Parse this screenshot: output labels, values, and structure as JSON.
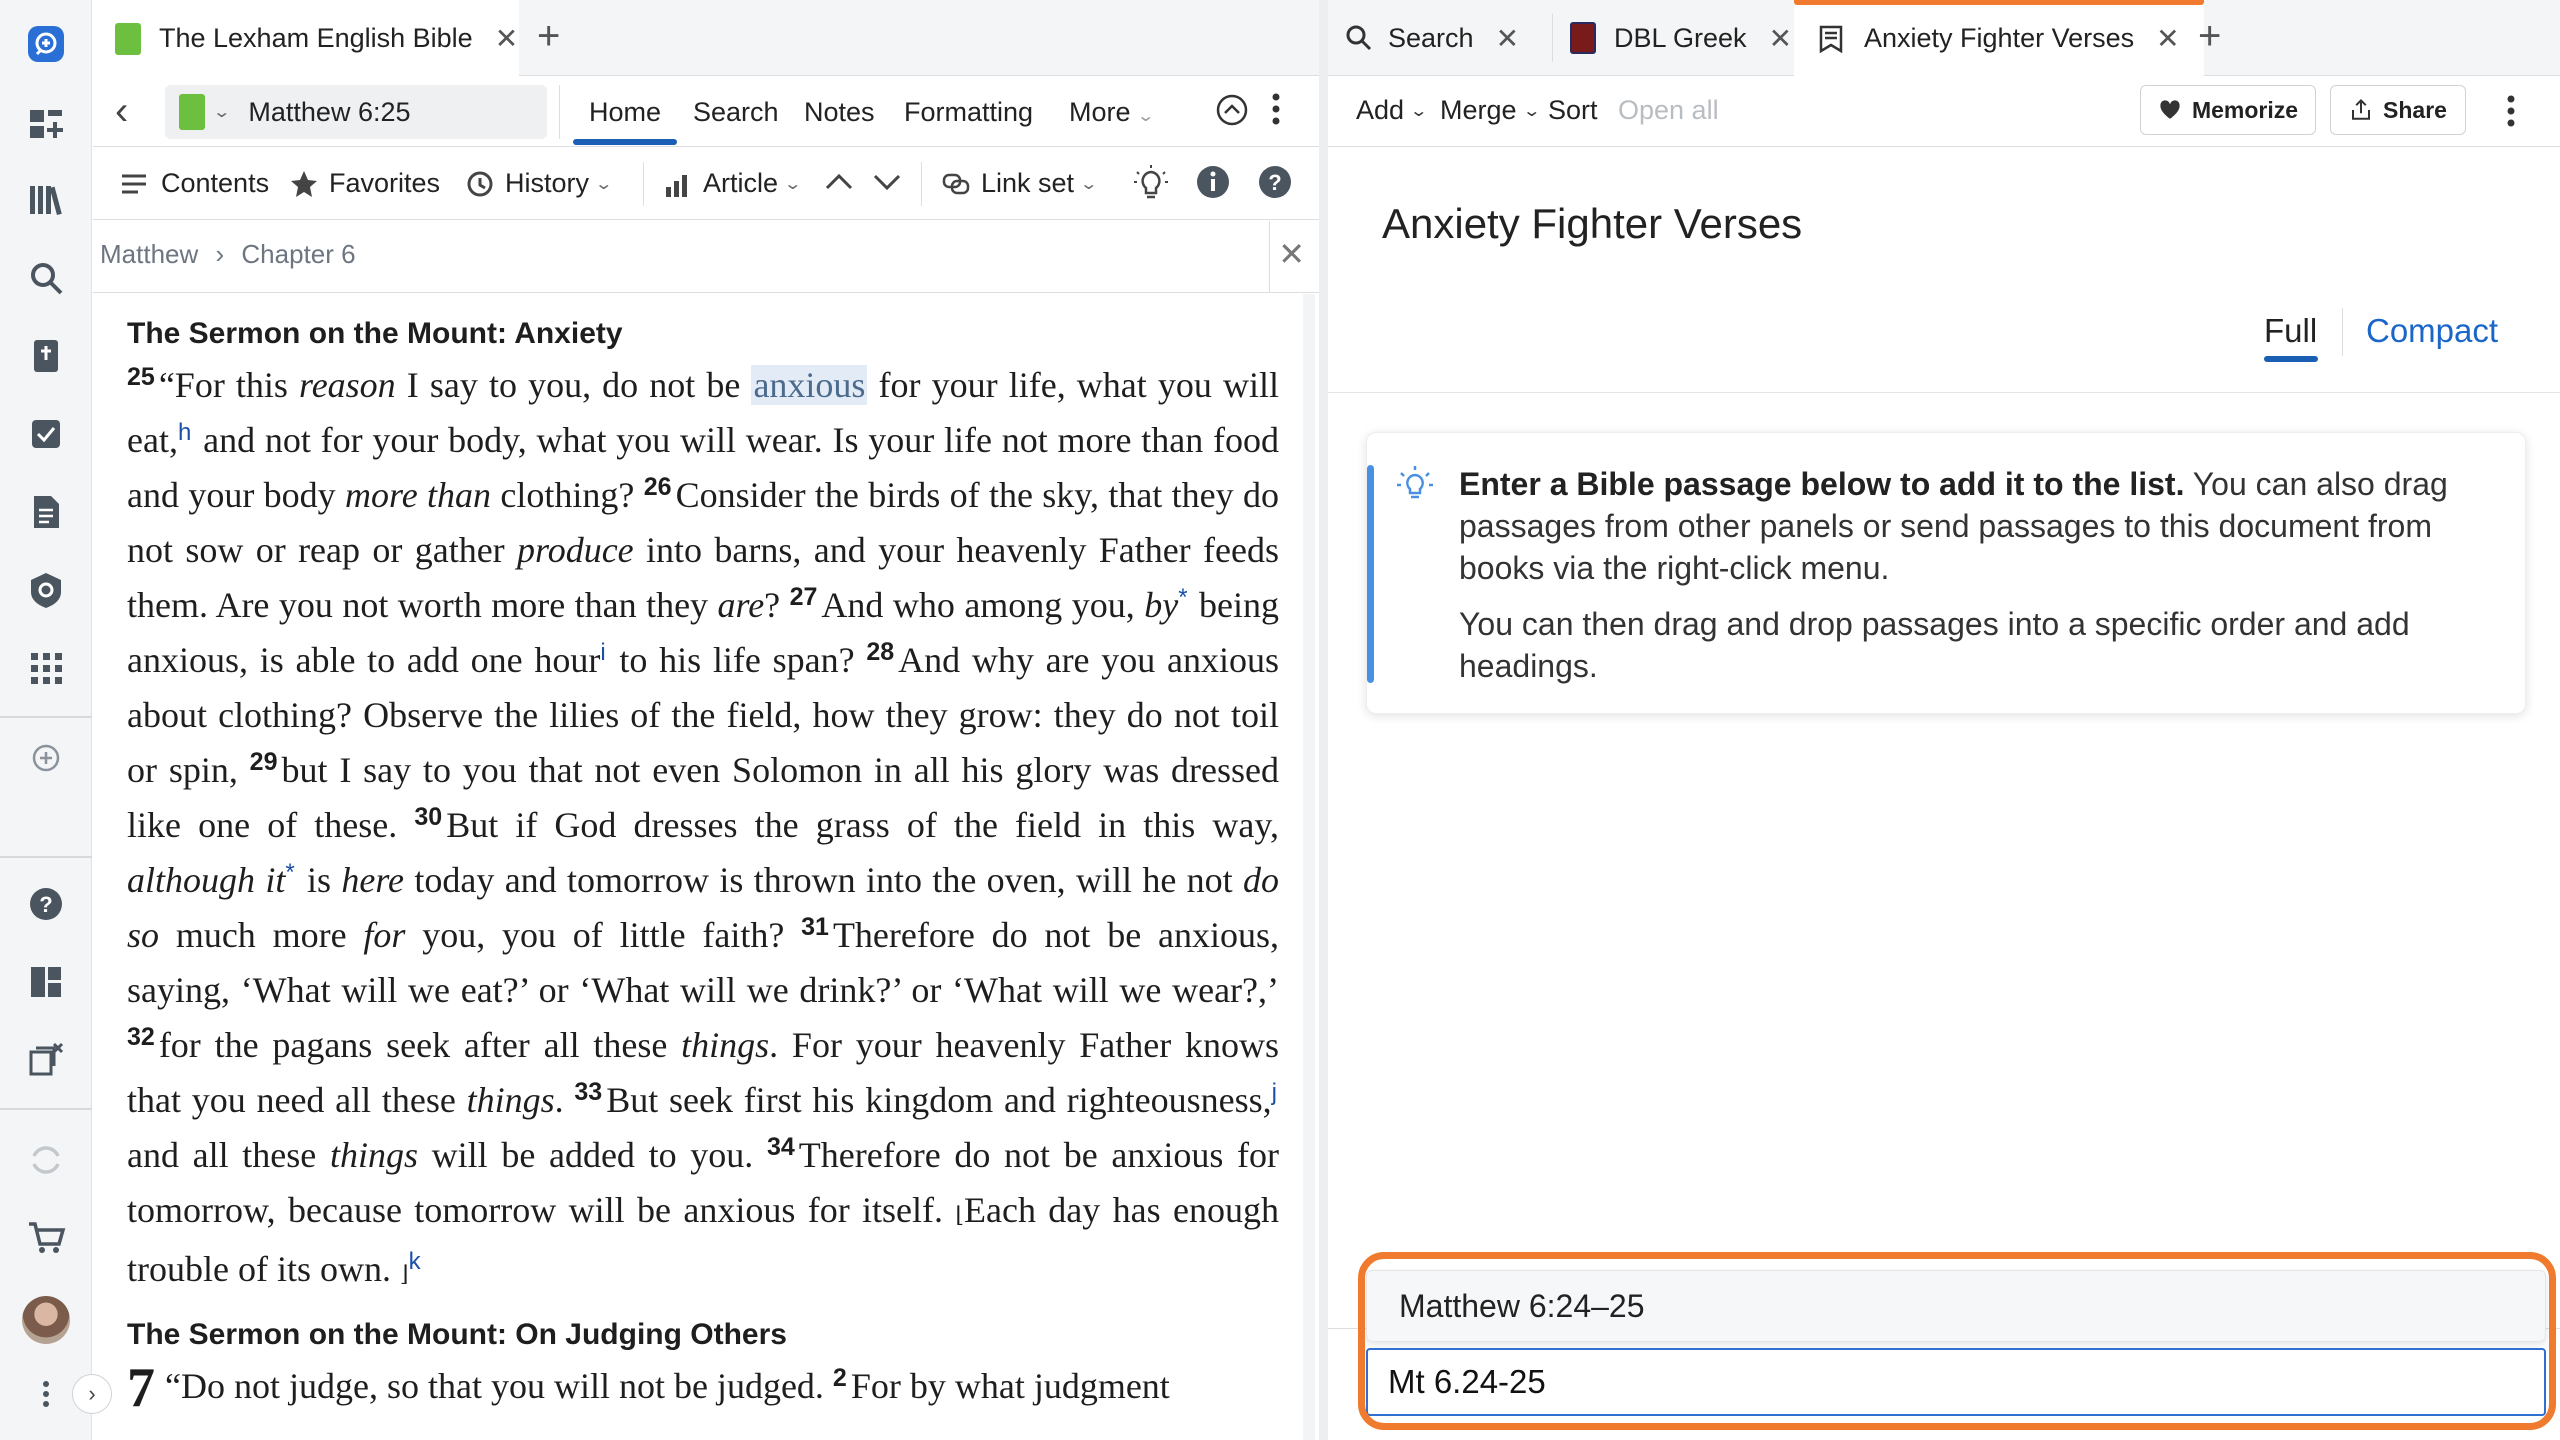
{
  "left_panel": {
    "tab": {
      "title": "The Lexham English Bible",
      "close": "✕"
    },
    "tab_add": "+",
    "reference": "Matthew 6:25",
    "nav": {
      "home": "Home",
      "search": "Search",
      "notes": "Notes",
      "formatting": "Formatting",
      "more": "More"
    },
    "toolbar": {
      "contents": "Contents",
      "favorites": "Favorites",
      "history": "History",
      "article": "Article",
      "link_set": "Link set"
    },
    "breadcrumb": {
      "book": "Matthew",
      "sep": "›",
      "chapter": "Chapter 6",
      "close": "✕"
    },
    "text": {
      "heading1": "The Sermon on the Mount: Anxiety",
      "v25_num": "25",
      "v25_a": "“For this ",
      "v25_reason": "reason",
      "v25_b": " I say to you, do not be ",
      "v25_anxious": "anxious",
      "v25_c": " for your life, what you will eat,",
      "note_h": "h",
      "v25_d": " and not for your body, what you will wear. Is your life not more than food and your body ",
      "v25_more_than": "more than",
      "v25_e": " clothing? ",
      "v26_num": "26",
      "v26_a": "Consider the birds of the sky, that they do not sow or reap or gather ",
      "v26_produce": "produce",
      "v26_b": " into barns, and your heavenly Father feeds them. Are you not worth more than they ",
      "v26_are": "are",
      "v26_c": "? ",
      "v27_num": "27",
      "v27_a": "And who among you, ",
      "v27_by": "by",
      "v27_star": "*",
      "v27_b": " being anxious, is able to add one hour",
      "note_i": "i",
      "v27_c": " to his life span? ",
      "v28_num": "28",
      "v28_a": "And why are you anxious about clothing? Observe the lilies of the field, how they grow: they do not toil or spin, ",
      "v29_num": "29",
      "v29_a": "but I say to you that not even Solomon in all his glory was dressed like one of these. ",
      "v30_num": "30",
      "v30_a": "But if God dresses the grass of the field in this way, ",
      "v30_although": "although it",
      "v30_star": "*",
      "v30_b": " is ",
      "v30_here": "here",
      "v30_c": " today and tomorrow is thrown into the oven, will he not ",
      "v30_doso": "do so",
      "v30_d": " much more ",
      "v30_for": "for",
      "v30_e": " you, you of little faith? ",
      "v31_num": "31",
      "v31_a": "Therefore do not be anxious, saying, ‘What will we eat?’ or ‘What will we drink?’ or ‘What will we wear?,’ ",
      "v32_num": "32",
      "v32_a": "for the pagans seek after all these ",
      "v32_things1": "things",
      "v32_b": ". For your heavenly Father knows that you need all these ",
      "v32_things2": "things",
      "v32_c": ". ",
      "v33_num": "33",
      "v33_a": "But seek first his kingdom and righteousness,",
      "note_j": "j",
      "v33_b": " and all these ",
      "v33_things": "things",
      "v33_c": " will be added to you. ",
      "v34_num": "34",
      "v34_a": "Therefore do not be anxious for tomorrow, because tomorrow will be anxious for itself. ",
      "v34_open": "⌊",
      "v34_b": "Each day has enough trouble of its own. ",
      "v34_close": "⌋",
      "note_k": "k",
      "heading2": "The Sermon on the Mount: On Judging Others",
      "ch7_num": "7",
      "v7_1": "“Do not judge, so that you will not be judged. ",
      "v7_2_num": "2",
      "v7_2": "For by what judgment"
    }
  },
  "right_panel": {
    "tabs": [
      {
        "title": "Search",
        "close": "✕"
      },
      {
        "title": "DBL Greek",
        "close": "✕"
      },
      {
        "title": "Anxiety Fighter Verses",
        "close": "✕"
      }
    ],
    "tab_add": "+",
    "toolbar": {
      "add": "Add",
      "merge": "Merge",
      "sort": "Sort",
      "open_all": "Open all",
      "memorize": "Memorize",
      "share": "Share"
    },
    "doc_title": "Anxiety Fighter Verses",
    "view": {
      "full": "Full",
      "compact": "Compact"
    },
    "info": {
      "bold": "Enter a Bible passage below to add it to the list.",
      "rest": " You can also drag passages from other panels or send passages to this document from books via the right-click menu.",
      "para2": "You can then drag and drop passages into a specific order and add headings."
    },
    "suggestion": "Matthew 6:24–25",
    "entry_value": "Mt 6.24-25"
  },
  "colors": {
    "accent_blue": "#1a5fb4",
    "callout_orange": "#f07a2d",
    "info_blue": "#4a90e2",
    "bible_green": "#6cbf3f"
  }
}
